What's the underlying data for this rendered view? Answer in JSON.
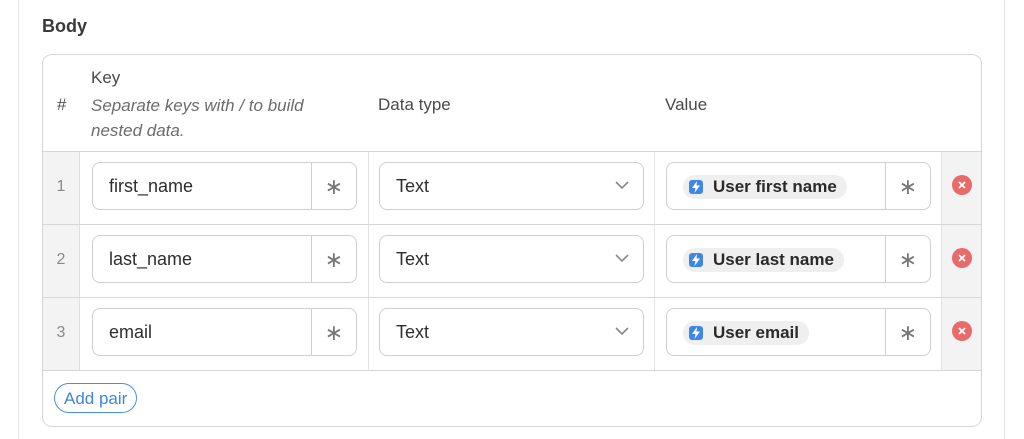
{
  "section": {
    "title": "Body"
  },
  "header": {
    "hash": "#",
    "key": "Key",
    "key_hint": "Separate keys with / to build nested data.",
    "data_type": "Data type",
    "value": "Value"
  },
  "rows": [
    {
      "num": "1",
      "key": "first_name",
      "data_type": "Text",
      "value": "User first name",
      "required_mark": "∗"
    },
    {
      "num": "2",
      "key": "last_name",
      "data_type": "Text",
      "value": "User last name",
      "required_mark": "∗"
    },
    {
      "num": "3",
      "key": "email",
      "data_type": "Text",
      "value": "User email",
      "required_mark": "∗"
    }
  ],
  "add_pair_label": "Add pair",
  "colors": {
    "accent": "#3f86e6",
    "delete": "#e96a6a",
    "border": "#d6d6d6"
  },
  "icons": {
    "value_chip": "lightning-icon",
    "dropdown": "chevron-down-icon",
    "delete": "close-circle-icon",
    "required": "asterisk-icon"
  }
}
